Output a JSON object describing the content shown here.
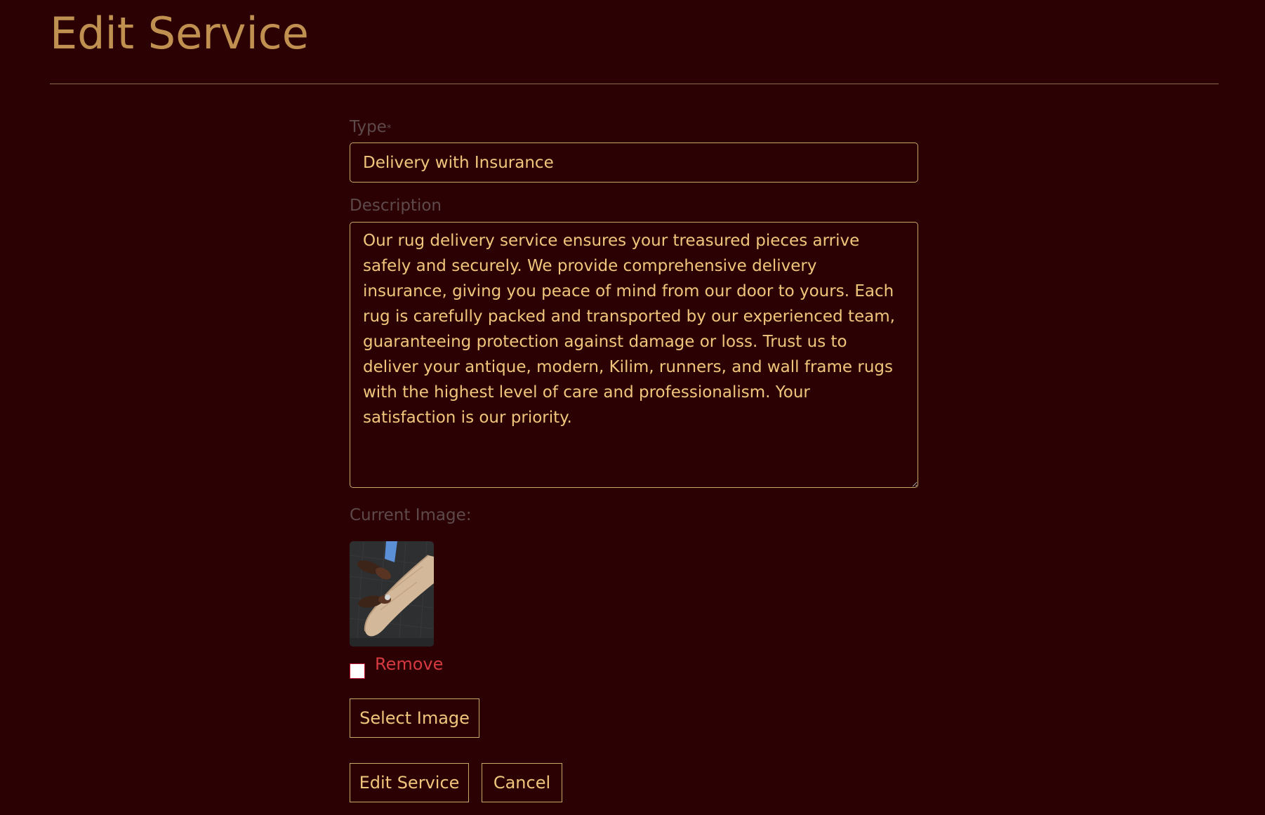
{
  "page": {
    "title": "Edit Service"
  },
  "form": {
    "type": {
      "label": "Type",
      "required_mark": "*",
      "value": "Delivery with Insurance"
    },
    "description": {
      "label": "Description",
      "value": "Our rug delivery service ensures your treasured pieces arrive safely and securely. We provide comprehensive delivery insurance, giving you peace of mind from our door to yours. Each rug is carefully packed and transported by our experienced team, guaranteeing protection against damage or loss. Trust us to deliver your antique, modern, Kilim, runners, and wall frame rugs with the highest level of care and professionalism. Your satisfaction is our priority."
    },
    "current_image": {
      "label": "Current Image:",
      "remove_label": "Remove",
      "remove_checked": false
    },
    "select_image_label": "Select Image",
    "submit_label": "Edit Service",
    "cancel_label": "Cancel"
  },
  "colors": {
    "background": "#2b0104",
    "accent": "#c09050",
    "text": "#f0c67c",
    "muted_label": "#5e4a4a",
    "danger": "#d43a40"
  }
}
